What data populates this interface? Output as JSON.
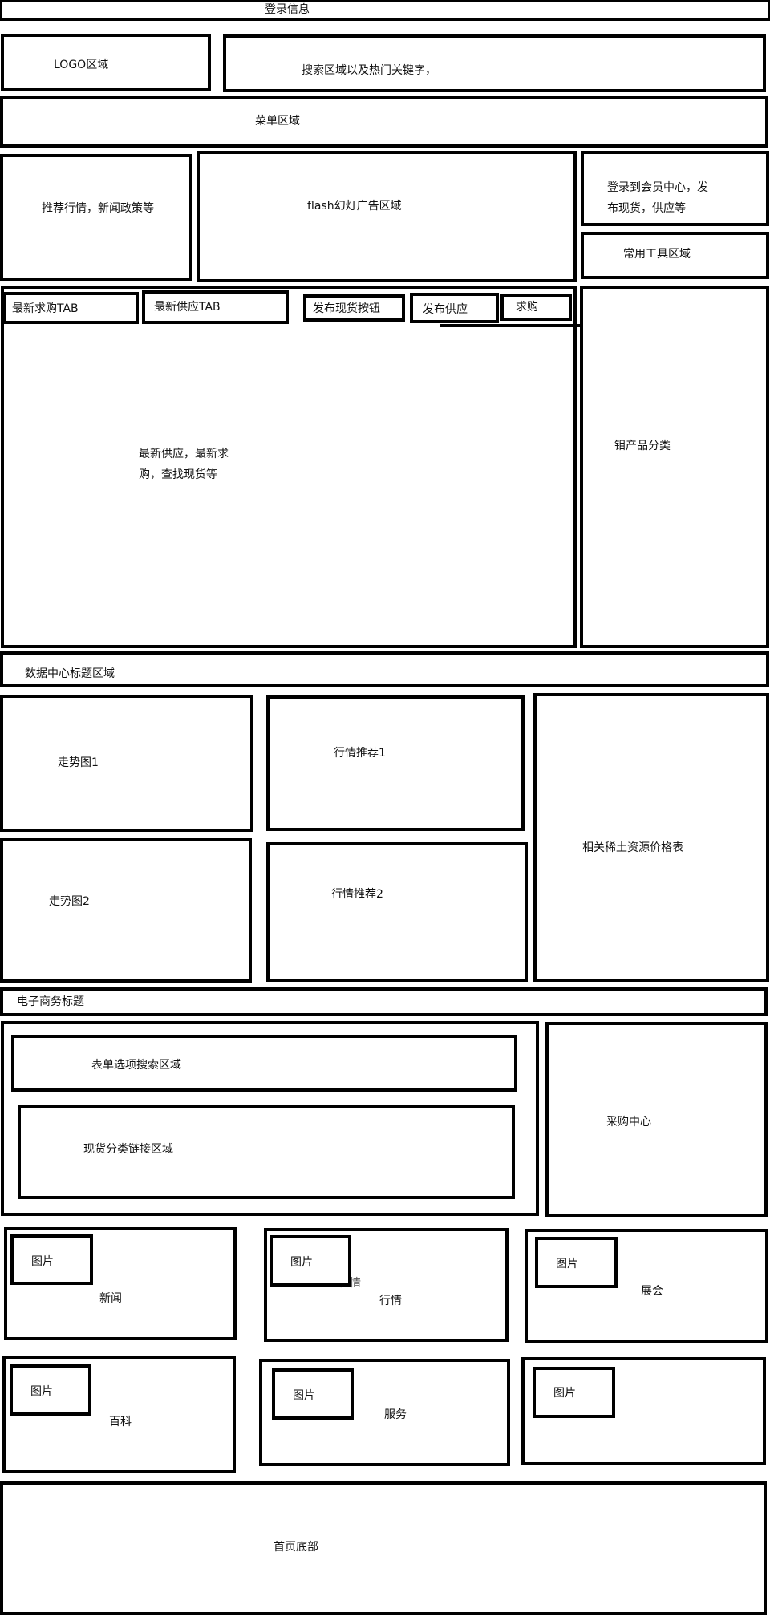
{
  "top": {
    "login_info": "登录信息",
    "logo": "LOGO区域",
    "search": "搜索区域以及热门关键字，",
    "menu": "菜单区域"
  },
  "hero": {
    "recommend": "推荐行情，新闻政策等",
    "flash": "flash幻灯广告区域",
    "member_line1": "登录到会员中心，发",
    "member_line2": "布现货，供应等",
    "tools": "常用工具区域"
  },
  "trade": {
    "tab_buy": "最新求购TAB",
    "tab_supply": "最新供应TAB",
    "btn_publish_stock": "发布现货按钮",
    "btn_publish_supply": "发布供应",
    "btn_buy": "求购",
    "main_line1": "最新供应，最新求",
    "main_line2": "购，查找现货等",
    "categories": "钼产品分类"
  },
  "data_center": {
    "title": "数据中心标题区域",
    "trend1": "走势图1",
    "trend2": "走势图2",
    "market1": "行情推荐1",
    "market2": "行情推荐2",
    "price_table": "相关稀土资源价格表"
  },
  "ecommerce": {
    "title": "电子商务标题",
    "form_search": "表单选项搜索区域",
    "stock_links": "现货分类链接区域",
    "purchase": "采购中心"
  },
  "cards": {
    "image": "图片",
    "news": "新闻",
    "market_overlap": "行情",
    "market": "行情",
    "expo": "展会",
    "wiki": "百科",
    "service": "服务"
  },
  "footer": {
    "label": "首页底部"
  }
}
